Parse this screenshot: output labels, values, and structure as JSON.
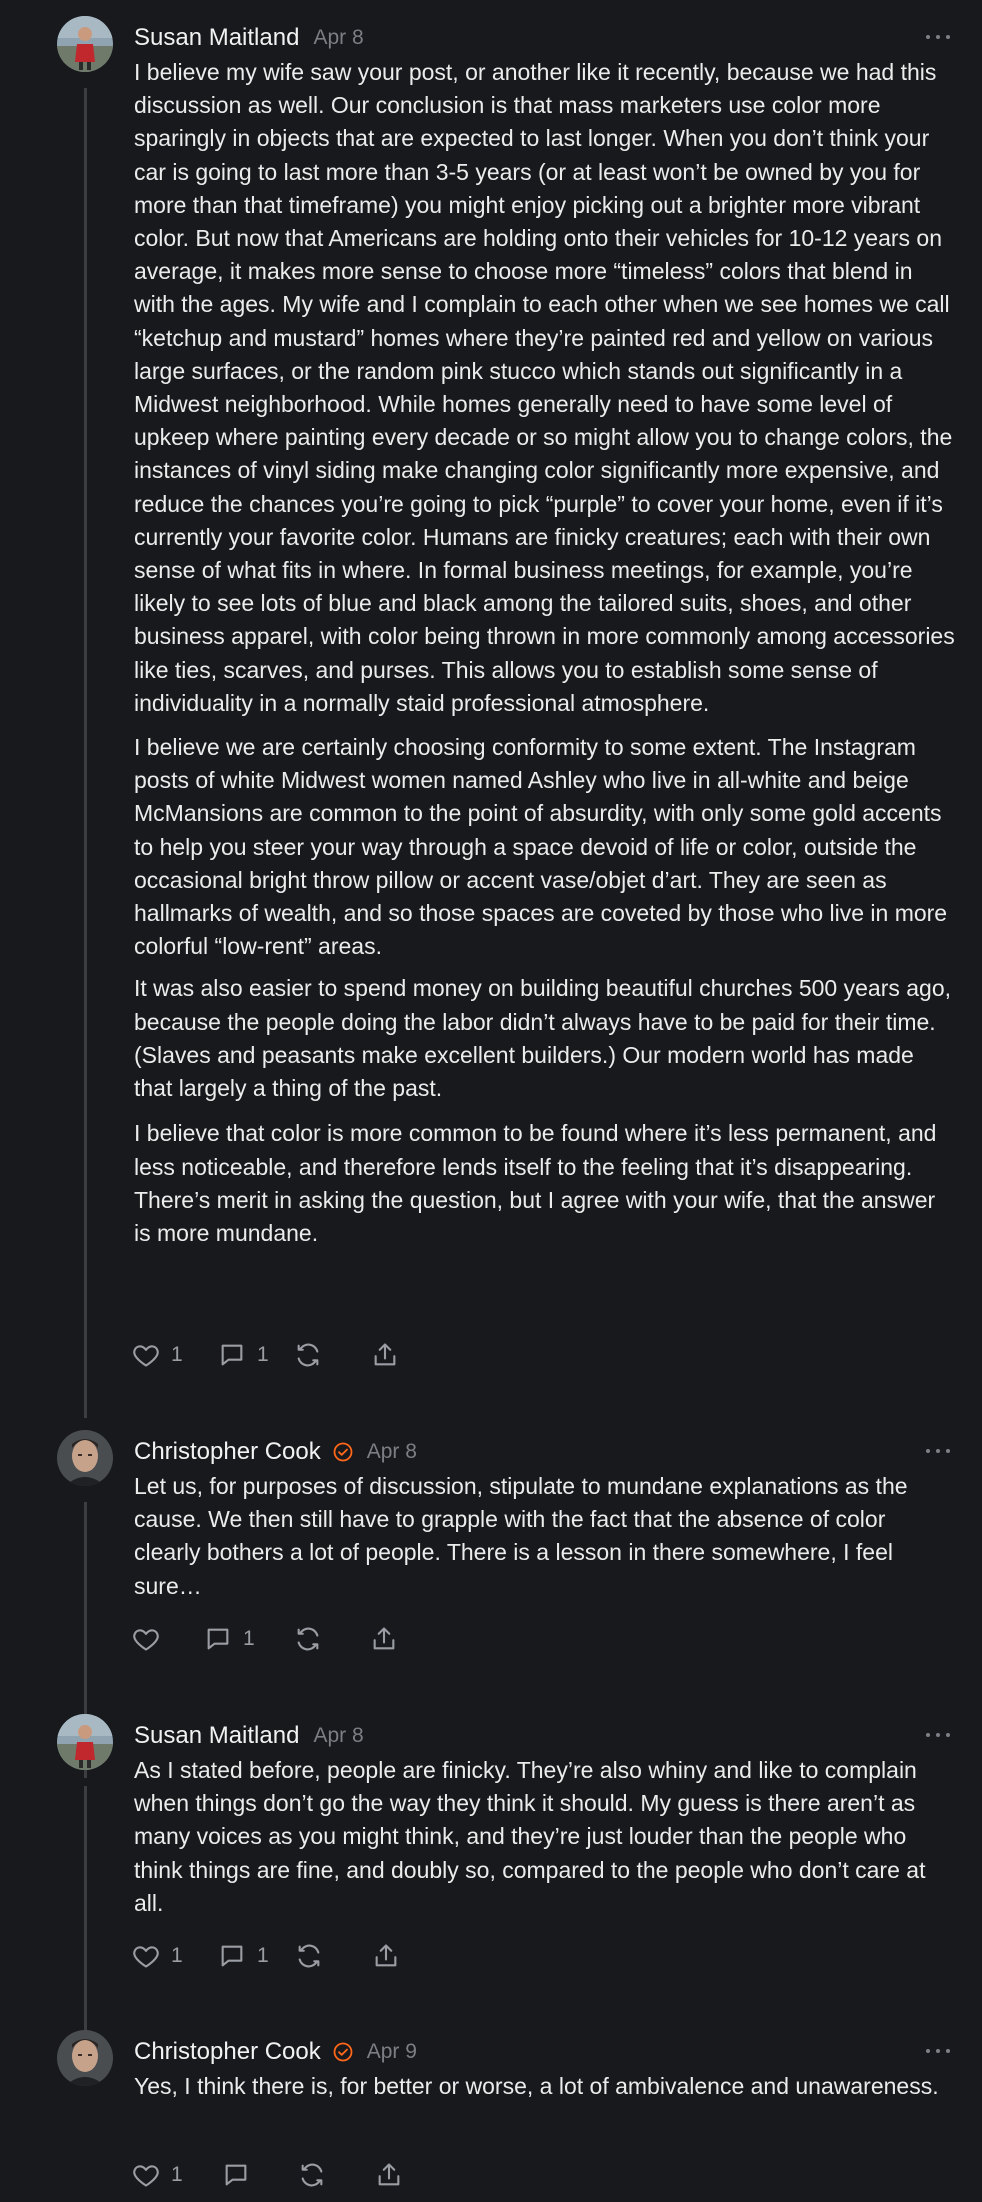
{
  "comments": [
    {
      "author": "Susan Maitland",
      "date": "Apr 8",
      "verified": false,
      "paragraphs": [
        "I believe my wife saw your post, or another like it recently, because we had this discussion as well. Our conclusion is that mass marketers use color more sparingly in objects that are expected to last longer. When you don’t think your car is going to last more than 3-5 years (or at least won’t be owned by you for more than that timeframe) you might enjoy picking out a brighter more vibrant color. But now that Americans are holding onto their vehicles for 10-12 years on average, it makes more sense to choose more “timeless” colors that blend in with the ages. My wife and I complain to each other when we see homes we call “ketchup and mustard” homes where they’re painted red and yellow on various large surfaces, or the random pink stucco which stands out significantly in a Midwest neighborhood. While homes generally need to have some level of upkeep where painting every decade or so might allow you to change colors, the instances of vinyl siding make changing color significantly more expensive, and reduce the chances you’re going to pick “purple” to cover your home, even if it’s currently your favorite color. Humans are finicky creatures; each with their own sense of what fits in where. In formal business meetings, for example, you’re likely to see lots of blue and black among the tailored suits, shoes, and other business apparel, with color being thrown in more commonly among accessories like ties, scarves, and purses. This allows you to establish some sense of individuality in a normally staid professional atmosphere.",
        "I believe we are certainly choosing conformity to some extent. The Instagram posts of white Midwest women named Ashley who live in all-white and beige McMansions are common to the point of absurdity, with only some gold accents to help you steer your way through a space devoid of life or color, outside the occasional bright throw pillow or accent vase/objet d’art. They are seen as hallmarks of wealth, and so those spaces are coveted by those who live in more colorful “low-rent” areas.",
        "It was also easier to spend money on building beautiful churches 500 years ago, because the people doing the labor didn’t always have to be paid for their time. (Slaves and peasants make excellent builders.) Our modern world has made that largely a thing of the past.",
        "I believe that color is more common to be found where it’s less permanent, and less noticeable, and therefore lends itself to the feeling that it’s disappearing. There’s merit in asking the question, but I agree with your wife, that the answer is more mundane."
      ],
      "likes": "1",
      "replies": "1"
    },
    {
      "author": "Christopher Cook",
      "date": "Apr 8",
      "verified": true,
      "paragraphs": [
        "Let us, for purposes of discussion, stipulate to mundane explanations as the cause. We then still have to grapple with the fact that the absence of color clearly bothers a lot of people. There is a lesson in there somewhere, I feel sure…"
      ],
      "likes": "",
      "replies": "1"
    },
    {
      "author": "Susan Maitland",
      "date": "Apr 8",
      "verified": false,
      "paragraphs": [
        "As I stated before, people are finicky. They’re also whiny and like to complain when things don’t go the way they think it should. My guess is there aren’t as many voices as you might think, and they’re just louder than the people who think things are fine, and doubly so, compared to the people who don’t care at all."
      ],
      "likes": "1",
      "replies": "1"
    },
    {
      "author": "Christopher Cook",
      "date": "Apr 9",
      "verified": true,
      "paragraphs": [
        "Yes, I think there is, for better or worse, a lot of ambivalence and unawareness."
      ],
      "likes": "1",
      "replies": ""
    }
  ],
  "icons": {
    "like": "heart-icon",
    "reply": "comment-icon",
    "restack": "restack-icon",
    "share": "share-icon",
    "more": "more-options-icon",
    "verified": "verified-badge-icon"
  },
  "colors": {
    "background": "#17191c",
    "text": "#ececec",
    "muted": "#7b7e84",
    "accent": "#ff6719",
    "thread_line": "#3b3d41"
  }
}
